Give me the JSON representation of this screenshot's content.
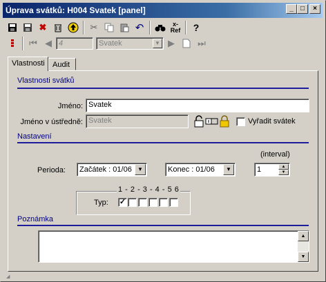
{
  "window": {
    "title": "Úprava svátků: H004 Svatek [panel]"
  },
  "titlebar_buttons": [
    "_",
    "□",
    "×"
  ],
  "toolbar1": [
    {
      "name": "save-icon",
      "glyph": "💾"
    },
    {
      "name": "save-as-icon",
      "glyph": "💾"
    },
    {
      "name": "delete-icon",
      "glyph": "✖"
    },
    {
      "name": "trash-icon",
      "glyph": "🗑"
    },
    {
      "name": "up-icon",
      "glyph": "⇧"
    },
    {
      "name": "cut-icon",
      "glyph": "✂"
    },
    {
      "name": "copy-icon",
      "glyph": "⎘"
    },
    {
      "name": "paste-icon",
      "glyph": "📋"
    },
    {
      "name": "undo-icon",
      "glyph": "↶"
    },
    {
      "name": "find-icon",
      "glyph": "🔍"
    },
    {
      "name": "refresh-icon",
      "glyph": "Ref"
    },
    {
      "name": "help-icon",
      "glyph": "?"
    }
  ],
  "navigator": {
    "record_number": "4",
    "record_name": "Svatek"
  },
  "tabs": [
    "Vlastnosti",
    "Audit"
  ],
  "section_properties": "Vlastnosti svátků",
  "label_name": "Jméno:",
  "value_name": "Svatek",
  "label_central_name": "Jméno v ústředně:",
  "value_central_name": "Svatek",
  "exclude_holiday_label": "Vyřadit svátek",
  "exclude_holiday_checked": false,
  "section_settings": "Nastavení",
  "label_period": "Perioda:",
  "period_start": "Začátek : 01/06",
  "period_end": "Konec : 01/06",
  "interval_label": "(interval)",
  "interval_value": "1",
  "type_numbers": "1 - 2 - 3 - 4 - 5  6",
  "type_label": "Typ:",
  "type_checks": [
    true,
    false,
    false,
    false,
    false,
    false
  ],
  "section_note": "Poznámka",
  "note_value": ""
}
